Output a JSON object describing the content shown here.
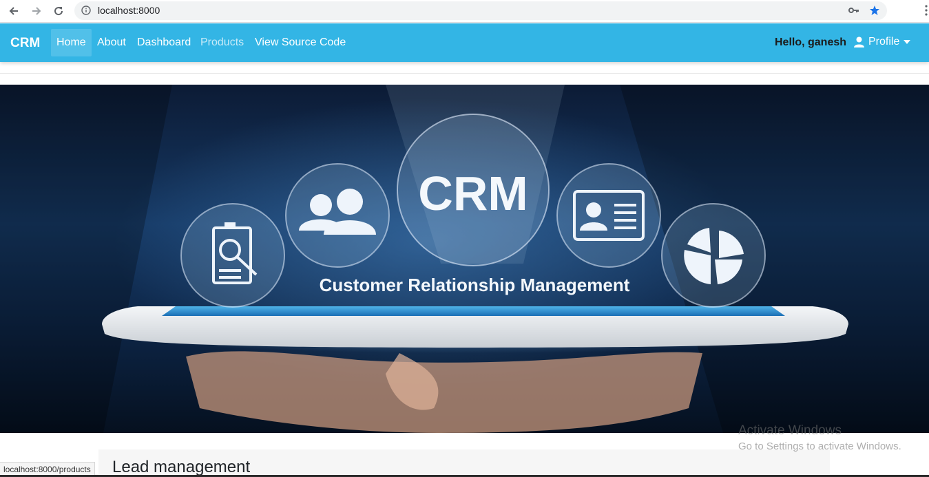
{
  "browser": {
    "url": "localhost:8000",
    "status_url": "localhost:8000/products",
    "icons": [
      "back-arrow-icon",
      "forward-arrow-icon",
      "reload-icon",
      "info-icon",
      "key-icon",
      "star-icon",
      "menu-dots-icon"
    ]
  },
  "navbar": {
    "brand": "CRM",
    "links": [
      "Home",
      "About",
      "Dashboard",
      "Products",
      "View Source Code"
    ],
    "greeting": "Hello, ganesh",
    "profile_label": "Profile",
    "bg_color": "#33b5e5"
  },
  "hero": {
    "badge_text": "CRM",
    "caption": "Customer Relationship Management"
  },
  "section": {
    "title": "Lead management"
  },
  "watermark": {
    "title": "Activate Windows",
    "subtitle": "Go to Settings to activate Windows."
  }
}
